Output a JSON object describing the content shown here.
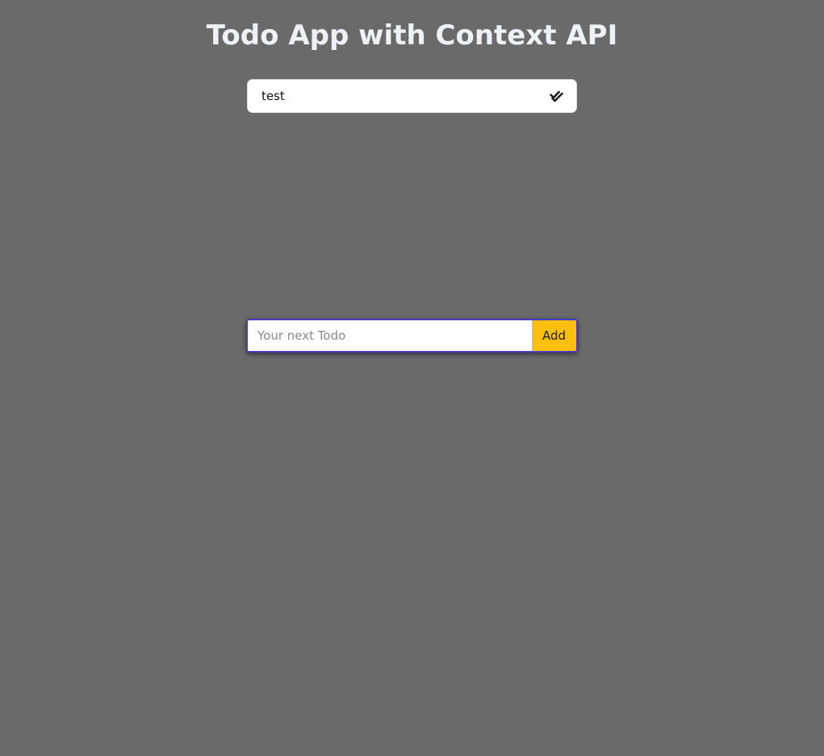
{
  "app": {
    "title": "Todo App with Context API"
  },
  "todos": [
    {
      "text": "test",
      "status_icon": "double-check-icon"
    }
  ],
  "form": {
    "input_value": "",
    "input_placeholder": "Your next Todo",
    "add_label": "Add"
  },
  "colors": {
    "background": "#6a6a6a",
    "title_text": "#eef2f7",
    "add_button": "#fbbf0f",
    "focus_ring": "#4b3cc8"
  }
}
